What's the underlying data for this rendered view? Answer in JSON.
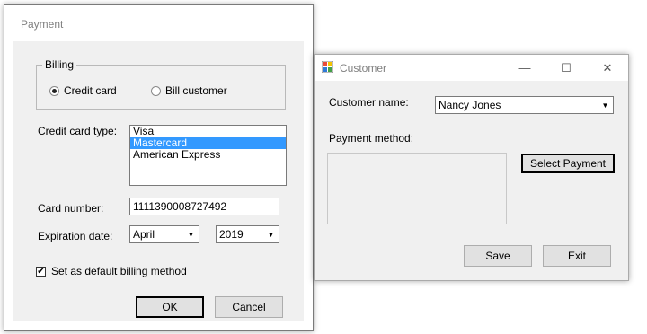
{
  "payment": {
    "title": "Payment",
    "billing": {
      "legend": "Billing",
      "options": [
        {
          "label": "Credit card",
          "selected": true
        },
        {
          "label": "Bill customer",
          "selected": false
        }
      ]
    },
    "card_type": {
      "label": "Credit card type:",
      "items": [
        "Visa",
        "Mastercard",
        "American Express"
      ],
      "selected": "Mastercard"
    },
    "card_number": {
      "label": "Card number:",
      "value": "1111390008727492"
    },
    "expiration": {
      "label": "Expiration date:",
      "month": "April",
      "year": "2019"
    },
    "default_billing": {
      "label": "Set as default billing method",
      "checked": true
    },
    "ok_label": "OK",
    "cancel_label": "Cancel"
  },
  "customer": {
    "title": "Customer",
    "name_label": "Customer name:",
    "name_value": "Nancy Jones",
    "payment_method_label": "Payment method:",
    "payment_method_value": "",
    "select_payment_label": "Select Payment",
    "save_label": "Save",
    "exit_label": "Exit"
  },
  "colors": {
    "selection": "#3399ff",
    "window_bg": "#f0f0f0",
    "title_text": "#808080"
  },
  "icons": [
    "minimize-icon",
    "maximize-icon",
    "close-icon",
    "dropdown-arrow-icon",
    "checkmark-icon",
    "app-icon"
  ]
}
